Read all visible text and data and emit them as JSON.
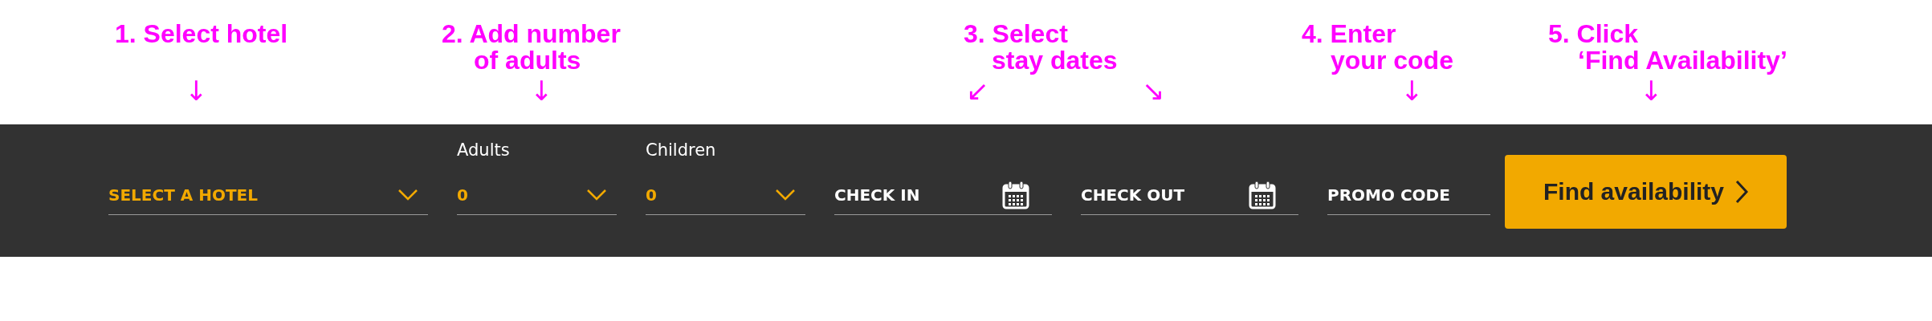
{
  "annotations": [
    {
      "lines": [
        "1. Select hotel"
      ],
      "arrows": [
        "↓"
      ]
    },
    {
      "lines": [
        "2. Add number",
        "of adults"
      ],
      "arrows": [
        "↓"
      ]
    },
    {
      "lines": [
        "3. Select",
        "stay dates"
      ],
      "arrows": [
        "↙",
        "↘"
      ]
    },
    {
      "lines": [
        "4. Enter",
        "your code"
      ],
      "arrows": [
        "↓"
      ]
    },
    {
      "lines": [
        "5. Click",
        "‘Find Availability’"
      ],
      "arrows": [
        "↓"
      ]
    }
  ],
  "search_bar": {
    "fields": [
      {
        "kind": "select",
        "placeholder": "SELECT A HOTEL"
      },
      {
        "kind": "select",
        "label": "Adults",
        "value": "0"
      },
      {
        "kind": "select",
        "label": "Children",
        "value": "0"
      },
      {
        "kind": "date",
        "placeholder": "CHECK IN"
      },
      {
        "kind": "date",
        "placeholder": "CHECK OUT"
      },
      {
        "kind": "text",
        "placeholder": "PROMO CODE"
      }
    ],
    "button": {
      "label": "Find availability"
    }
  }
}
